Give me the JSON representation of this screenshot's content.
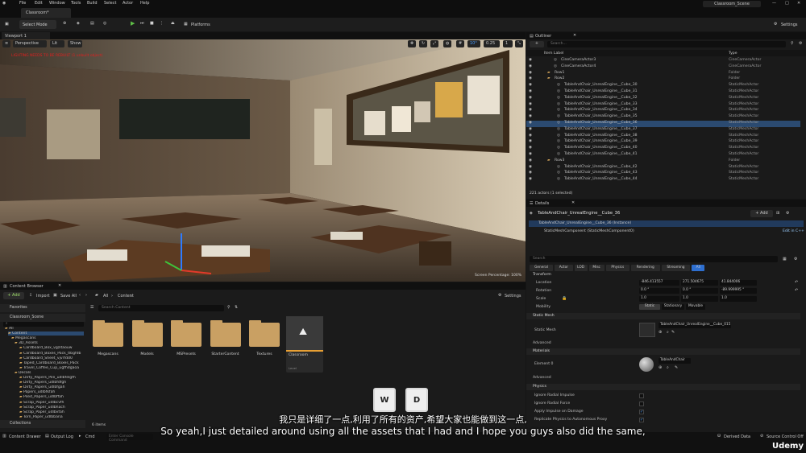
{
  "menu": {
    "items": [
      "File",
      "Edit",
      "Window",
      "Tools",
      "Build",
      "Select",
      "Actor",
      "Help"
    ],
    "project_name": "Classroom_Scene"
  },
  "level_tab": "Classroom*",
  "toolbar": {
    "select_mode": "Select Mode",
    "platforms": "Platforms",
    "settings": "Settings"
  },
  "viewport": {
    "tab": "Viewport 1",
    "perspective": "Perspective",
    "lit": "Lit",
    "show": "Show",
    "warning": "LIGHTING NEEDS TO BE REBUILT (1 unbuilt object)",
    "snap_angle": "10°",
    "snap_scale": "0.25",
    "camera_speed": "1",
    "screen_percentage": "Screen Percentage: 100%"
  },
  "outliner": {
    "title": "Outliner",
    "search_placeholder": "Search...",
    "col_label": "Item Label",
    "col_type": "Type",
    "rows": [
      {
        "name": "CineCameraActor3",
        "type": "CineCameraActor"
      },
      {
        "name": "CineCameraActor4",
        "type": "CineCameraActor"
      },
      {
        "name": "Row1",
        "type": "Folder"
      },
      {
        "name": "Row2",
        "type": "Folder"
      },
      {
        "name": "TableAndChair_UnrealEngine__Cube_30",
        "type": "StaticMeshActor"
      },
      {
        "name": "TableAndChair_UnrealEngine__Cube_31",
        "type": "StaticMeshActor"
      },
      {
        "name": "TableAndChair_UnrealEngine__Cube_32",
        "type": "StaticMeshActor"
      },
      {
        "name": "TableAndChair_UnrealEngine__Cube_33",
        "type": "StaticMeshActor"
      },
      {
        "name": "TableAndChair_UnrealEngine__Cube_34",
        "type": "StaticMeshActor"
      },
      {
        "name": "TableAndChair_UnrealEngine__Cube_35",
        "type": "StaticMeshActor"
      },
      {
        "name": "TableAndChair_UnrealEngine__Cube_36",
        "type": "StaticMeshActor"
      },
      {
        "name": "TableAndChair_UnrealEngine__Cube_37",
        "type": "StaticMeshActor"
      },
      {
        "name": "TableAndChair_UnrealEngine__Cube_38",
        "type": "StaticMeshActor"
      },
      {
        "name": "TableAndChair_UnrealEngine__Cube_39",
        "type": "StaticMeshActor"
      },
      {
        "name": "TableAndChair_UnrealEngine__Cube_40",
        "type": "StaticMeshActor"
      },
      {
        "name": "TableAndChair_UnrealEngine__Cube_41",
        "type": "StaticMeshActor"
      },
      {
        "name": "Row3",
        "type": "Folder"
      },
      {
        "name": "TableAndChair_UnrealEngine__Cube_42",
        "type": "StaticMeshActor"
      },
      {
        "name": "TableAndChair_UnrealEngine__Cube_43",
        "type": "StaticMeshActor"
      },
      {
        "name": "TableAndChair_UnrealEngine__Cube_44",
        "type": "StaticMeshActor"
      }
    ],
    "count": "221 actors (1 selected)"
  },
  "details": {
    "title": "Details",
    "actor_name": "TableAndChair_UnrealEngine__Cube_36",
    "add": "+ Add",
    "instance": "TableAndChair_UnrealEngine__Cube_36 (Instance)",
    "component": "StaticMeshComponent (StaticMeshComponent0)",
    "edit_cpp": "Edit in C++",
    "search_placeholder": "Search",
    "filters": [
      "General",
      "Actor",
      "LOD",
      "Misc",
      "Physics",
      "Rendering",
      "Streaming",
      "All"
    ],
    "transform_header": "Transform",
    "location_label": "Location",
    "location": [
      "-846.413557",
      "271.504675",
      "41.844006"
    ],
    "rotation_label": "Rotation",
    "rotation": [
      "0.0 °",
      "0.0 °",
      "-89.999995 °"
    ],
    "scale_label": "Scale",
    "scale": [
      "1.0",
      "1.0",
      "1.0"
    ],
    "mobility_label": "Mobility",
    "mobility": [
      "Static",
      "Stationary",
      "Movable"
    ],
    "static_mesh_header": "Static Mesh",
    "static_mesh_label": "Static Mesh",
    "static_mesh_value": "TableAndChair_UnrealEngine__Cube_015",
    "advanced": "Advanced",
    "materials_header": "Materials",
    "element_label": "Element 0",
    "material_value": "TableAndChair",
    "physics_header": "Physics",
    "physics_rows": [
      "Ignore Radial Impulse",
      "Ignore Radial Force",
      "Apply Impulse on Damage",
      "Replicate Physics to Autonomous Proxy"
    ]
  },
  "content_browser": {
    "title": "Content Browser",
    "add": "+ Add",
    "import": "Import",
    "save_all": "Save All",
    "path": [
      "All",
      "Content"
    ],
    "settings": "Settings",
    "favorites": "Favorites",
    "project": "Classroom_Scene",
    "search_placeholder": "Search Content",
    "tree": [
      "All",
      "Content",
      "Megascans",
      "3D_Assets",
      "Cardboard_Box_vgzitaouw",
      "Cardboard_Boxes_Pack_tlbgfdb",
      "Cardboard_Sheet_vjvrfdd0",
      "Taped_Cardboard_Boxes_Pack",
      "Travel_Coffee_Cup_ugfhdgaoa",
      "Decals",
      "Dirty_Papers_Pile_udlbfelgfh",
      "Dirty_Papers_udlbfdfgh",
      "Dirty_Papers_udlbfgah",
      "Papers_udlbfkfah",
      "Piled_Papers_udlbffah",
      "Scrap_Paper_udlbcvfh",
      "Scrap_Paper_udlbhach",
      "Scrap_Paper_udlbvfah",
      "Torn_Paper_udlbbana"
    ],
    "folders": [
      "Megascans",
      "Models",
      "MSPresets",
      "StarterContent",
      "Textures"
    ],
    "level_asset": "Classroom",
    "level_asset_type": "Level",
    "items_count": "6 items",
    "collections": "Collections"
  },
  "statusbar": {
    "content_drawer": "Content Drawer",
    "output_log": "Output Log",
    "cmd": "Cmd",
    "cmd_placeholder": "Enter Console Command",
    "derived_data": "Derived Data",
    "source_control": "Source Control Off"
  },
  "keys": [
    "W",
    "D"
  ],
  "subtitles": {
    "cn": "我只是详细了一点,利用了所有的资产,希望大家也能做到这一点,",
    "en": "So yeah,I just detailed around using all the assets that I had and I hope you guys also did the same,"
  },
  "watermark": "Udemy"
}
